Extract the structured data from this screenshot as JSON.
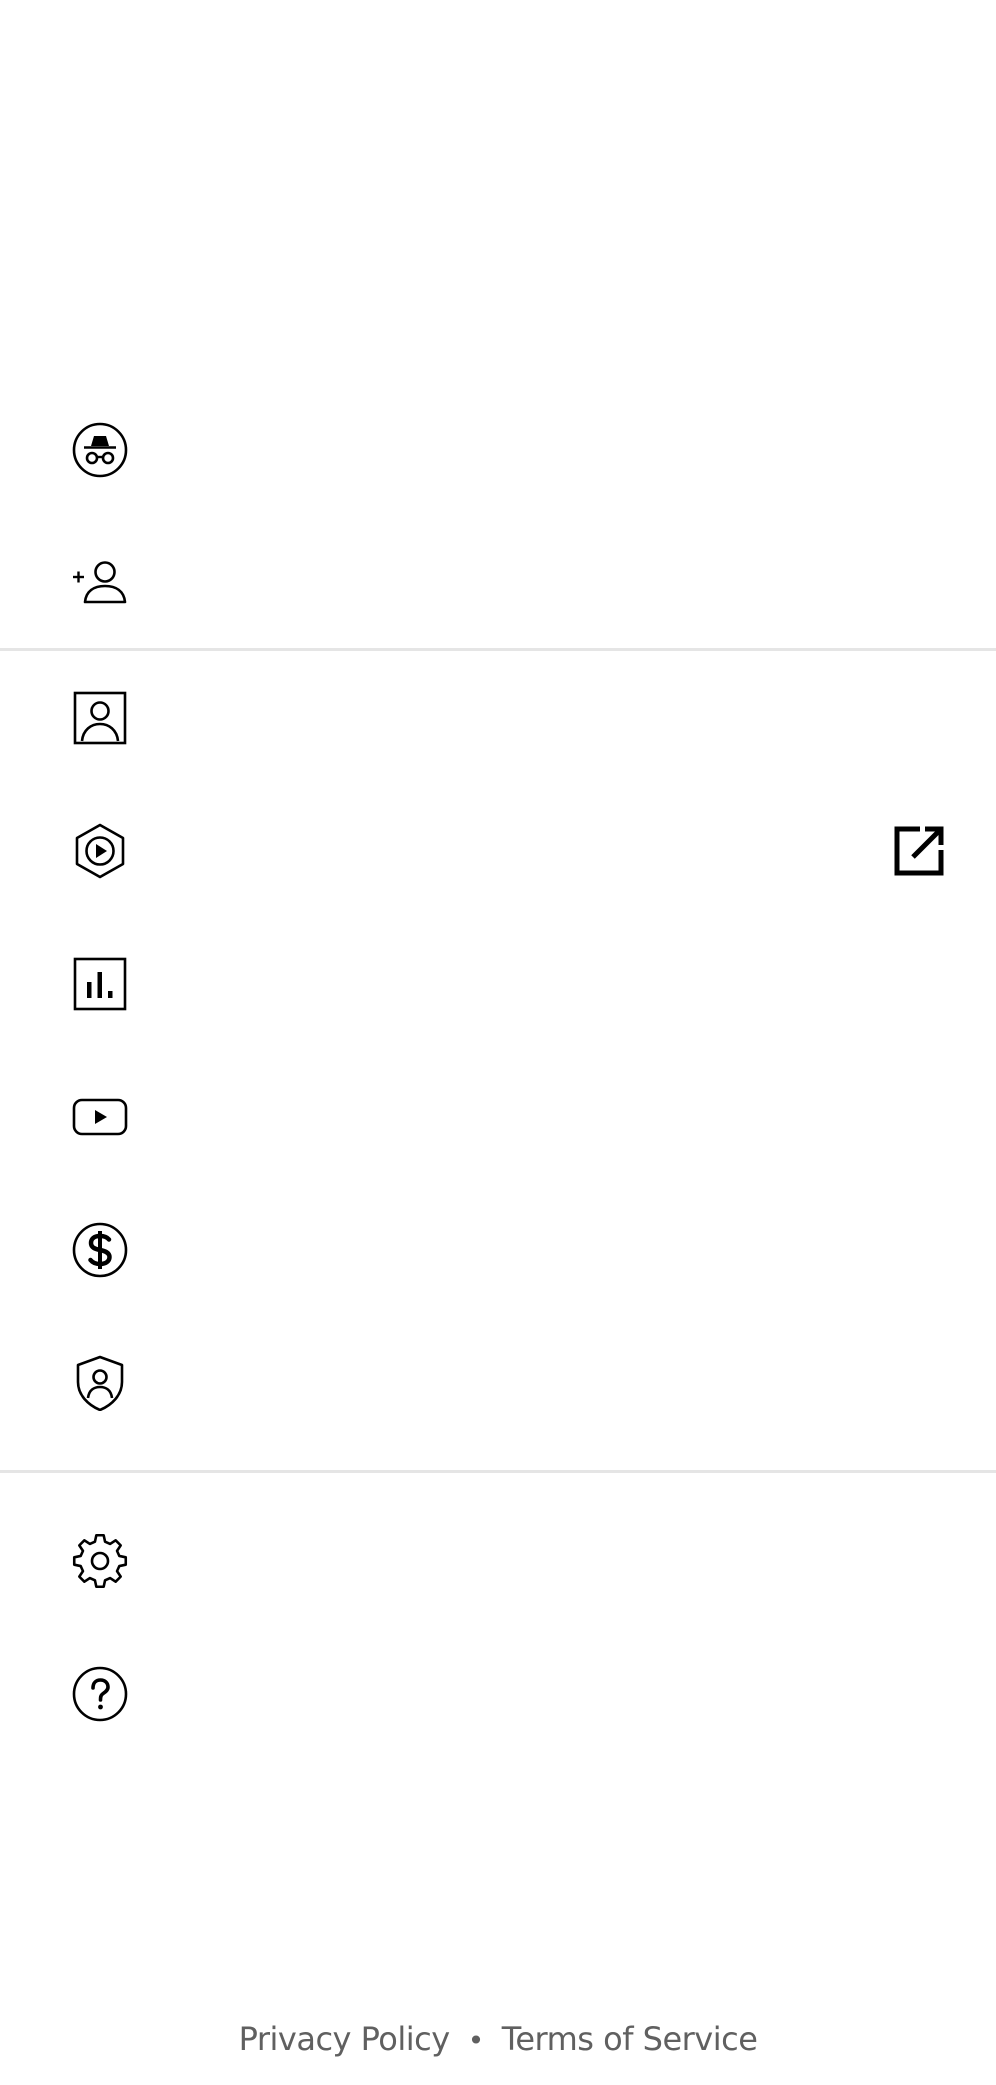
{
  "menu": {
    "items": [
      {
        "id": "incognito",
        "icon": "incognito-icon",
        "label": ""
      },
      {
        "id": "add-account",
        "icon": "add-account-icon",
        "label": ""
      },
      {
        "id": "your-channel",
        "icon": "your-channel-icon",
        "label": ""
      },
      {
        "id": "studio",
        "icon": "studio-icon",
        "label": "",
        "trailing_icon": "open-external-icon"
      },
      {
        "id": "time-watched",
        "icon": "time-watched-icon",
        "label": ""
      },
      {
        "id": "get-premium",
        "icon": "premium-icon",
        "label": ""
      },
      {
        "id": "purchases-memberships",
        "icon": "dollar-icon",
        "label": ""
      },
      {
        "id": "your-data",
        "icon": "shield-person-icon",
        "label": ""
      },
      {
        "id": "settings",
        "icon": "gear-icon",
        "label": ""
      },
      {
        "id": "help-feedback",
        "icon": "help-icon",
        "label": ""
      }
    ]
  },
  "footer": {
    "privacy_policy": "Privacy Policy",
    "separator": "•",
    "terms_of_service": "Terms of Service"
  },
  "colors": {
    "icon": "#000000",
    "divider": "#e5e5e5",
    "footer_text": "#606060",
    "background": "#ffffff"
  }
}
